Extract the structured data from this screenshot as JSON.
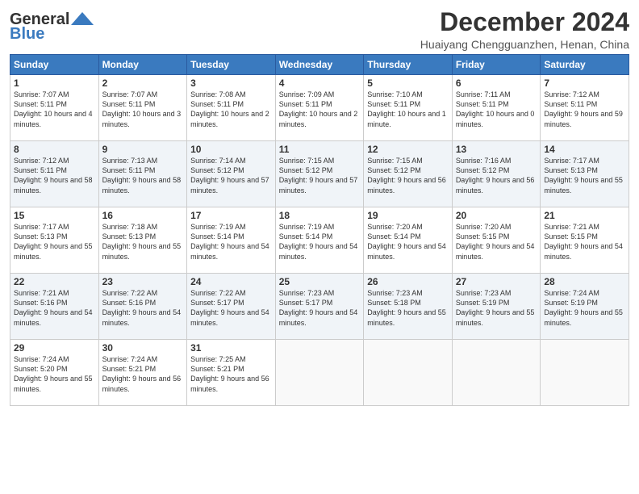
{
  "header": {
    "logo_line1": "General",
    "logo_line2": "Blue",
    "month": "December 2024",
    "location": "Huaiyang Chengguanzhen, Henan, China"
  },
  "weekdays": [
    "Sunday",
    "Monday",
    "Tuesday",
    "Wednesday",
    "Thursday",
    "Friday",
    "Saturday"
  ],
  "weeks": [
    [
      {
        "day": "1",
        "sunrise": "7:07 AM",
        "sunset": "5:11 PM",
        "daylight": "10 hours and 4 minutes."
      },
      {
        "day": "2",
        "sunrise": "7:07 AM",
        "sunset": "5:11 PM",
        "daylight": "10 hours and 3 minutes."
      },
      {
        "day": "3",
        "sunrise": "7:08 AM",
        "sunset": "5:11 PM",
        "daylight": "10 hours and 2 minutes."
      },
      {
        "day": "4",
        "sunrise": "7:09 AM",
        "sunset": "5:11 PM",
        "daylight": "10 hours and 2 minutes."
      },
      {
        "day": "5",
        "sunrise": "7:10 AM",
        "sunset": "5:11 PM",
        "daylight": "10 hours and 1 minute."
      },
      {
        "day": "6",
        "sunrise": "7:11 AM",
        "sunset": "5:11 PM",
        "daylight": "10 hours and 0 minutes."
      },
      {
        "day": "7",
        "sunrise": "7:12 AM",
        "sunset": "5:11 PM",
        "daylight": "9 hours and 59 minutes."
      }
    ],
    [
      {
        "day": "8",
        "sunrise": "7:12 AM",
        "sunset": "5:11 PM",
        "daylight": "9 hours and 58 minutes."
      },
      {
        "day": "9",
        "sunrise": "7:13 AM",
        "sunset": "5:11 PM",
        "daylight": "9 hours and 58 minutes."
      },
      {
        "day": "10",
        "sunrise": "7:14 AM",
        "sunset": "5:12 PM",
        "daylight": "9 hours and 57 minutes."
      },
      {
        "day": "11",
        "sunrise": "7:15 AM",
        "sunset": "5:12 PM",
        "daylight": "9 hours and 57 minutes."
      },
      {
        "day": "12",
        "sunrise": "7:15 AM",
        "sunset": "5:12 PM",
        "daylight": "9 hours and 56 minutes."
      },
      {
        "day": "13",
        "sunrise": "7:16 AM",
        "sunset": "5:12 PM",
        "daylight": "9 hours and 56 minutes."
      },
      {
        "day": "14",
        "sunrise": "7:17 AM",
        "sunset": "5:13 PM",
        "daylight": "9 hours and 55 minutes."
      }
    ],
    [
      {
        "day": "15",
        "sunrise": "7:17 AM",
        "sunset": "5:13 PM",
        "daylight": "9 hours and 55 minutes."
      },
      {
        "day": "16",
        "sunrise": "7:18 AM",
        "sunset": "5:13 PM",
        "daylight": "9 hours and 55 minutes."
      },
      {
        "day": "17",
        "sunrise": "7:19 AM",
        "sunset": "5:14 PM",
        "daylight": "9 hours and 54 minutes."
      },
      {
        "day": "18",
        "sunrise": "7:19 AM",
        "sunset": "5:14 PM",
        "daylight": "9 hours and 54 minutes."
      },
      {
        "day": "19",
        "sunrise": "7:20 AM",
        "sunset": "5:14 PM",
        "daylight": "9 hours and 54 minutes."
      },
      {
        "day": "20",
        "sunrise": "7:20 AM",
        "sunset": "5:15 PM",
        "daylight": "9 hours and 54 minutes."
      },
      {
        "day": "21",
        "sunrise": "7:21 AM",
        "sunset": "5:15 PM",
        "daylight": "9 hours and 54 minutes."
      }
    ],
    [
      {
        "day": "22",
        "sunrise": "7:21 AM",
        "sunset": "5:16 PM",
        "daylight": "9 hours and 54 minutes."
      },
      {
        "day": "23",
        "sunrise": "7:22 AM",
        "sunset": "5:16 PM",
        "daylight": "9 hours and 54 minutes."
      },
      {
        "day": "24",
        "sunrise": "7:22 AM",
        "sunset": "5:17 PM",
        "daylight": "9 hours and 54 minutes."
      },
      {
        "day": "25",
        "sunrise": "7:23 AM",
        "sunset": "5:17 PM",
        "daylight": "9 hours and 54 minutes."
      },
      {
        "day": "26",
        "sunrise": "7:23 AM",
        "sunset": "5:18 PM",
        "daylight": "9 hours and 55 minutes."
      },
      {
        "day": "27",
        "sunrise": "7:23 AM",
        "sunset": "5:19 PM",
        "daylight": "9 hours and 55 minutes."
      },
      {
        "day": "28",
        "sunrise": "7:24 AM",
        "sunset": "5:19 PM",
        "daylight": "9 hours and 55 minutes."
      }
    ],
    [
      {
        "day": "29",
        "sunrise": "7:24 AM",
        "sunset": "5:20 PM",
        "daylight": "9 hours and 55 minutes."
      },
      {
        "day": "30",
        "sunrise": "7:24 AM",
        "sunset": "5:21 PM",
        "daylight": "9 hours and 56 minutes."
      },
      {
        "day": "31",
        "sunrise": "7:25 AM",
        "sunset": "5:21 PM",
        "daylight": "9 hours and 56 minutes."
      },
      null,
      null,
      null,
      null
    ]
  ],
  "labels": {
    "sunrise": "Sunrise:",
    "sunset": "Sunset:",
    "daylight": "Daylight:"
  }
}
